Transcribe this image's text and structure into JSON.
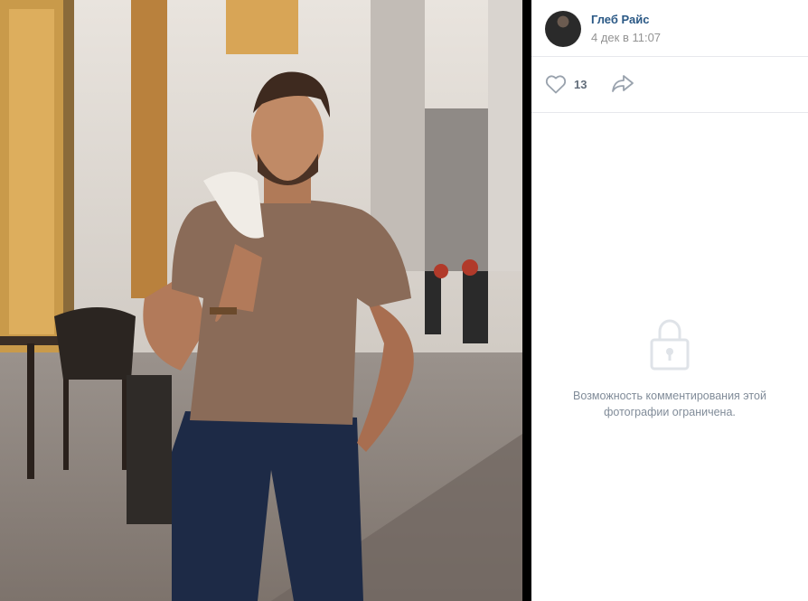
{
  "post": {
    "author_name": "Глеб Райс",
    "date": "4 дек в 11:07",
    "likes": "13"
  },
  "comments": {
    "restricted_message": "Возможность комментирования этой фотографии ограничена."
  },
  "icons": {
    "like": "heart-icon",
    "share": "share-arrow-icon",
    "lock": "lock-icon"
  },
  "colors": {
    "author_link": "#2a5885",
    "muted": "#939393",
    "action": "#626d7a",
    "divider": "#e7e8ec"
  }
}
